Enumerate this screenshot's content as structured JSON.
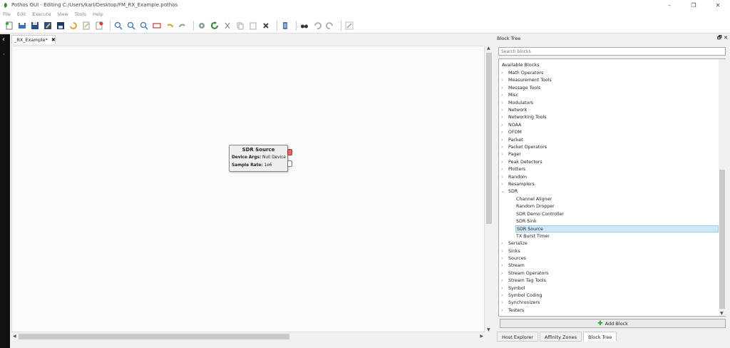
{
  "window": {
    "title": "Pothos GUI - Editing C:/Users/karl/Desktop/FM_RX_Example.pothos",
    "minimize": "–",
    "restore": "❐",
    "close": "✕"
  },
  "menu": [
    "File",
    "Edit",
    "Execute",
    "View",
    "Tools",
    "Help"
  ],
  "editor": {
    "tab_label": "_RX_Example*",
    "tab_close": "✖",
    "left_arrow": "‹",
    "block": {
      "title": "SDR Source",
      "device_args_label": "Device Args:",
      "device_args_value": "Null Device",
      "sample_rate_label": "Sample Rate:",
      "sample_rate_value": "1e6"
    }
  },
  "block_tree": {
    "panel_title": "Block Tree",
    "search_placeholder": "Search blocks",
    "root_label": "Available Blocks",
    "categories_before": [
      "Math Operators",
      "Measurement Tools",
      "Message Tools",
      "Misc",
      "Modulators",
      "Network",
      "Networking Tools",
      "NOAA",
      "OFDM",
      "Packet",
      "Packet Operators",
      "Pager",
      "Peak Detectors",
      "Plotters",
      "Random",
      "Resamplers"
    ],
    "expanded_category": "SDR",
    "sdr_children": [
      "Channel Aligner",
      "Random Dropper",
      "SDR Demo Controller",
      "SDR Sink",
      "SDR Source",
      "TX Burst Timer"
    ],
    "selected_child": "SDR Source",
    "categories_after": [
      "Serialize",
      "Sinks",
      "Sources",
      "Stream",
      "Stream Operators",
      "Stream Tag Tools",
      "Symbol",
      "Symbol Coding",
      "Synchronizers",
      "Testers"
    ],
    "add_block_label": "Add Block"
  },
  "dock_tabs": [
    "Host Explorer",
    "Affinity Zones",
    "Block Tree"
  ],
  "active_dock_tab": "Block Tree",
  "colors": {
    "accent_selected": "#cfe7f7",
    "port_red": "#e06666",
    "canvas_bg": "#f8fbfb"
  }
}
